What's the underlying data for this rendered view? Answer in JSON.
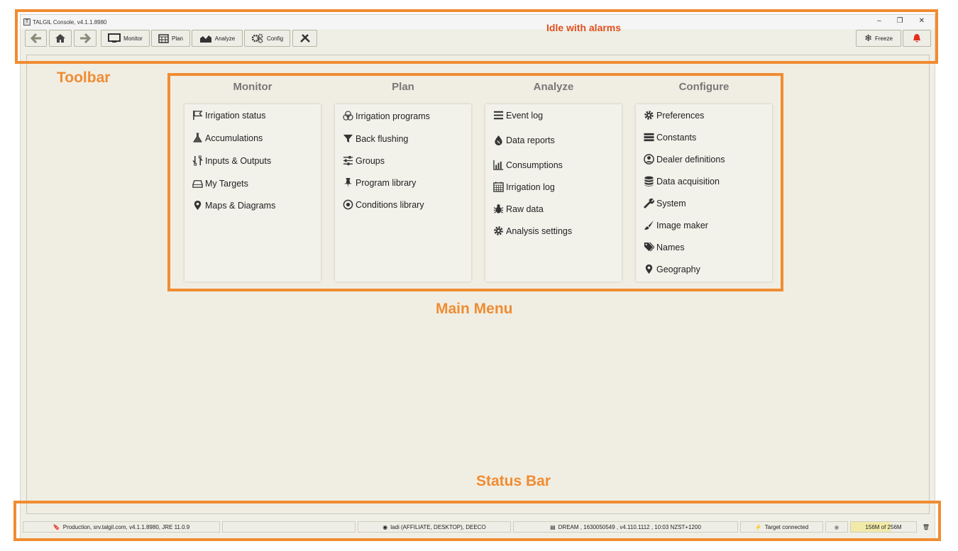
{
  "window": {
    "title": "TALGIL Console, v4.1.1.8980",
    "controls": [
      "–",
      "❐",
      "✕"
    ]
  },
  "toolbar": {
    "back_icon": "arrow-left-icon",
    "home_icon": "home-icon",
    "forward_icon": "arrow-right-icon",
    "monitor_label": "Monitor",
    "plan_label": "Plan",
    "analyze_label": "Analyze",
    "config_label": "Config",
    "tools_icon": "tools-icon",
    "status_text": "Idle with alarms",
    "freeze_label": "Freeze",
    "alarm_icon": "bell-icon",
    "status_color": "#e0501e"
  },
  "menu": {
    "columns": [
      {
        "title": "Monitor",
        "items": [
          {
            "label": "Irrigation status",
            "icon": "flag-icon"
          },
          {
            "label": "Accumulations",
            "icon": "flask-icon"
          },
          {
            "label": "Inputs & Outputs",
            "icon": "io-icon"
          },
          {
            "label": "My Targets",
            "icon": "drive-icon"
          },
          {
            "label": "Maps & Diagrams",
            "icon": "map-marker-icon"
          }
        ]
      },
      {
        "title": "Plan",
        "items": [
          {
            "label": "Irrigation programs",
            "icon": "circles-icon"
          },
          {
            "label": "Back flushing",
            "icon": "filter-icon"
          },
          {
            "label": "Groups",
            "icon": "sliders-icon"
          },
          {
            "label": "Program library",
            "icon": "pin-icon"
          },
          {
            "label": "Conditions library",
            "icon": "dot-circle-icon"
          }
        ]
      },
      {
        "title": "Analyze",
        "items": [
          {
            "label": "Event log",
            "icon": "list-icon"
          },
          {
            "label": "Data reports",
            "icon": "drop-icon"
          },
          {
            "label": "Consumptions",
            "icon": "bar-chart-icon"
          },
          {
            "label": "Irrigation log",
            "icon": "calendar-icon"
          },
          {
            "label": "Raw data",
            "icon": "bug-icon"
          },
          {
            "label": "Analysis settings",
            "icon": "gear-icon"
          }
        ]
      },
      {
        "title": "Configure",
        "items": [
          {
            "label": "Preferences",
            "icon": "gear-icon"
          },
          {
            "label": "Constants",
            "icon": "server-icon"
          },
          {
            "label": "Dealer definitions",
            "icon": "user-circle-icon"
          },
          {
            "label": "Data acquisition",
            "icon": "database-icon"
          },
          {
            "label": "System",
            "icon": "wrench-icon"
          },
          {
            "label": "Image maker",
            "icon": "brush-icon"
          },
          {
            "label": "Names",
            "icon": "tags-icon"
          },
          {
            "label": "Geography",
            "icon": "map-marker-icon"
          }
        ]
      }
    ]
  },
  "statusbar": {
    "server": "Production, srv.talgil.com, v4.1.1.8980, JRE 11.0.9",
    "empty": "",
    "user": "ladi (AFFILIATE, DESKTOP), DEECO",
    "target": "DREAM , 1630050549 , v4.110.1112 , 10:03 NZST+1200",
    "connection": "Target connected",
    "memory": "156M of 256M",
    "memory_fraction": 0.61
  },
  "annotations": {
    "toolbar": "Toolbar",
    "main_menu": "Main Menu",
    "status_bar": "Status Bar",
    "color": "#f08c32"
  }
}
